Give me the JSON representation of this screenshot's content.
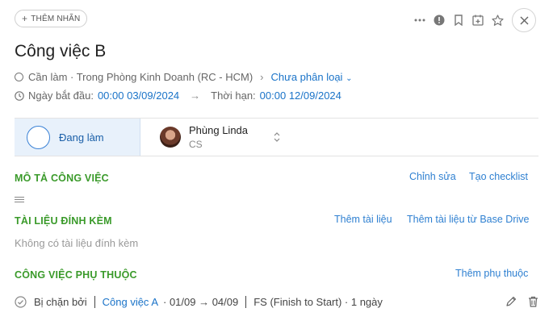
{
  "header": {
    "tag_button": "THÊM NHÃN",
    "title": "Công việc B"
  },
  "meta": {
    "status_text": "Cần làm · Trong Phòng Kinh Doanh (RC - HCM)",
    "category": "Chưa phân loại",
    "start_label": "Ngày bắt đầu:",
    "start_value": "00:00 03/09/2024",
    "deadline_label": "Thời hạn:",
    "deadline_value": "00:00 12/09/2024"
  },
  "status_bar": {
    "status_label": "Đang làm",
    "assignee_name": "Phùng Linda",
    "assignee_role": "CS"
  },
  "description": {
    "title": "MÔ TẢ CÔNG VIỆC",
    "edit_link": "Chỉnh sửa",
    "checklist_link": "Tạo checklist"
  },
  "attachments": {
    "title": "TÀI LIỆU ĐÍNH KÈM",
    "add_link": "Thêm tài liệu",
    "add_drive_link": "Thêm tài liệu từ Base Drive",
    "empty_text": "Không có tài liệu đính kèm"
  },
  "dependencies": {
    "title": "CÔNG VIỆC PHỤ THUỘC",
    "add_link": "Thêm phụ thuộc",
    "items": [
      {
        "relation": "Bị chặn bởi",
        "task": "Công việc A",
        "dates": "· 01/09 → 04/09",
        "type": "FS (Finish to Start) · 1 ngày"
      }
    ]
  },
  "colors": {
    "accent": "#2f80d1",
    "section": "#3a9a2a",
    "status_bg": "#e8f1fb"
  }
}
